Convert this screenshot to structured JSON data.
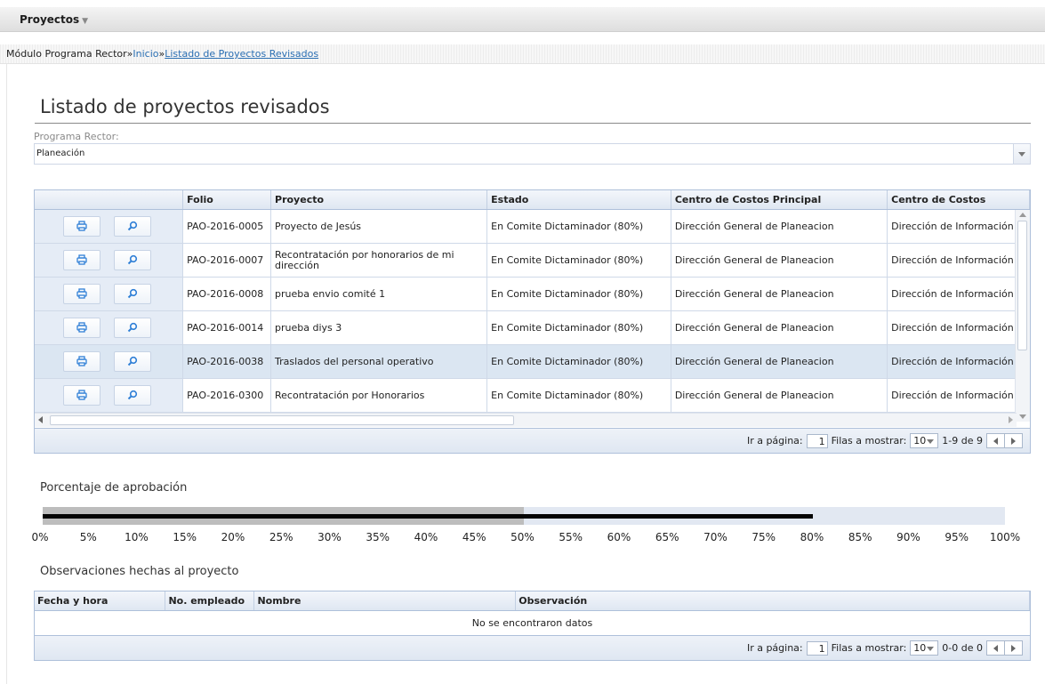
{
  "menu": {
    "label": "Proyectos",
    "caret": "▼"
  },
  "breadcrumb": {
    "module": "Módulo Programa Rector",
    "sep": "»",
    "home": "Inicio",
    "current": "Listado de Proyectos Revisados"
  },
  "page": {
    "title": "Listado de proyectos revisados",
    "program_label": "Programa Rector:",
    "program_value": "Planeación"
  },
  "grid": {
    "columns": [
      "",
      "Folio",
      "Proyecto",
      "Estado",
      "Centro de Costos Principal",
      "Centro de Costos"
    ],
    "rows": [
      {
        "folio": "PAO-2016-0005",
        "proyecto": "Proyecto de Jesús",
        "estado": "En Comite Dictaminador (80%)",
        "centro_principal": "Dirección General de Planeacion",
        "centro": "Dirección de Información"
      },
      {
        "folio": "PAO-2016-0007",
        "proyecto": "Recontratación por honorarios de mi dirección",
        "estado": "En Comite Dictaminador (80%)",
        "centro_principal": "Dirección General de Planeacion",
        "centro": "Dirección de Información"
      },
      {
        "folio": "PAO-2016-0008",
        "proyecto": "prueba envio comité 1",
        "estado": "En Comite Dictaminador (80%)",
        "centro_principal": "Dirección General de Planeacion",
        "centro": "Dirección de Información"
      },
      {
        "folio": "PAO-2016-0014",
        "proyecto": "prueba diys 3",
        "estado": "En Comite Dictaminador (80%)",
        "centro_principal": "Dirección General de Planeacion",
        "centro": "Dirección de Información"
      },
      {
        "folio": "PAO-2016-0038",
        "proyecto": "Traslados del personal operativo",
        "estado": "En Comite Dictaminador (80%)",
        "centro_principal": "Dirección General de Planeacion",
        "centro": "Dirección de Información",
        "selected": true
      },
      {
        "folio": "PAO-2016-0300",
        "proyecto": "Recontratación por Honorarios",
        "estado": "En Comite Dictaminador (80%)",
        "centro_principal": "Dirección General de Planeacion",
        "centro": "Dirección de Información"
      }
    ],
    "row_icons": [
      "print-icon",
      "magnifier-icon"
    ],
    "pager": {
      "goto_label": "Ir a página:",
      "page": "1",
      "rows_label": "Filas a mostrar:",
      "rows_value": "10",
      "range": "1-9 de 9"
    }
  },
  "approval": {
    "label": "Porcentaje de aprobación",
    "approved_percent": 50,
    "state_percent": 80,
    "ticks": [
      "0%",
      "5%",
      "10%",
      "15%",
      "20%",
      "25%",
      "30%",
      "35%",
      "40%",
      "45%",
      "50%",
      "55%",
      "60%",
      "65%",
      "70%",
      "75%",
      "80%",
      "85%",
      "90%",
      "95%",
      "100%"
    ],
    "colors": {
      "fill": "#bdbdbd",
      "line": "#050505",
      "track": "#e2e8f2"
    }
  },
  "observations": {
    "label": "Observaciones hechas al proyecto",
    "columns": [
      "Fecha y hora",
      "No. empleado",
      "Nombre",
      "Observación"
    ],
    "empty": "No se encontraron datos",
    "pager": {
      "goto_label": "Ir a página:",
      "page": "1",
      "rows_label": "Filas a mostrar:",
      "rows_value": "10",
      "range": "0-0 de 0"
    }
  }
}
